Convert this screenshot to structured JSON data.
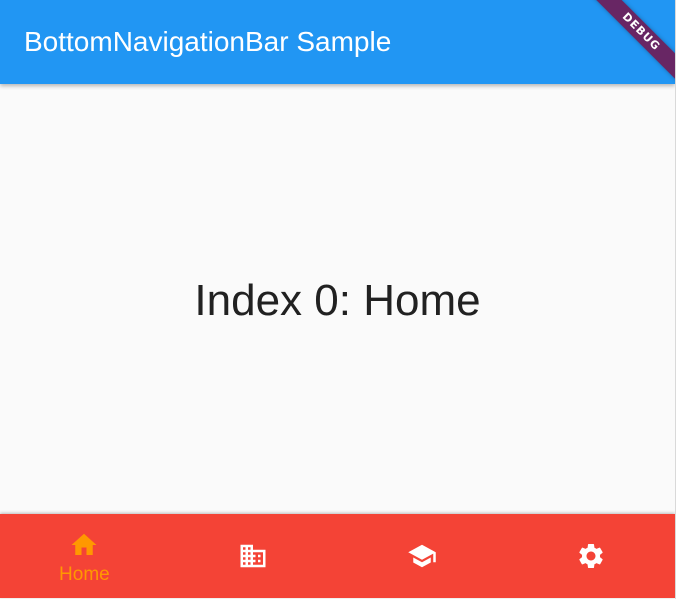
{
  "app": {
    "title": "BottomNavigationBar Sample",
    "debug_banner": "DEBUG"
  },
  "body": {
    "selected_text": "Index 0: Home"
  },
  "bottom_nav": {
    "background_color": "#f44336",
    "selected_color": "#ff9800",
    "unselected_color": "#ffffff",
    "selected_index": 0,
    "items": [
      {
        "label": "Home",
        "icon": "home-icon",
        "selected": true
      },
      {
        "label": "",
        "icon": "business-icon",
        "selected": false
      },
      {
        "label": "",
        "icon": "school-icon",
        "selected": false
      },
      {
        "label": "",
        "icon": "settings-icon",
        "selected": false
      }
    ]
  },
  "colors": {
    "app_bar": "#2196f3",
    "body_background": "#fafafa",
    "body_text": "#212121"
  }
}
